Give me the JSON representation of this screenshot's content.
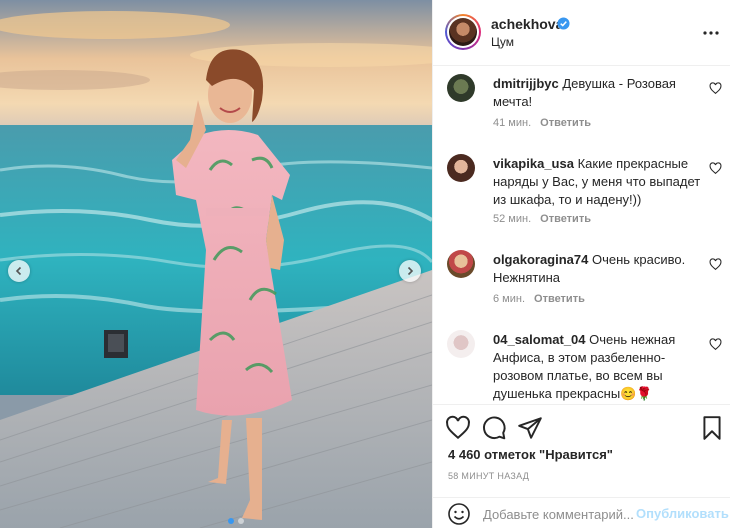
{
  "post": {
    "username": "achekhova",
    "location": "Цум",
    "likes_text": "4 460 отметок \"Нравится\"",
    "time_ago": "58 МИНУТ НАЗАД"
  },
  "comments": [
    {
      "user": "dmitrijjbyc",
      "text": "Девушка - Розовая мечта!",
      "time": "41 мин.",
      "reply": "Ответить"
    },
    {
      "user": "vikapika_usa",
      "text": "Какие прекрасные наряды у Вас, у меня что выпадет из шкафа, то и надену!))",
      "time": "52 мин.",
      "reply": "Ответить"
    },
    {
      "user": "olgakoragina74",
      "text": "Очень красиво. Нежнятина",
      "time": "6 мин.",
      "reply": "Ответить"
    },
    {
      "user": "04_salomat_04",
      "text": "Очень нежная Анфиса, в этом разбеленно-розовом платье, во всем вы душенька прекрасны😊🌹",
      "time": "",
      "reply": ""
    }
  ],
  "add_comment": {
    "placeholder": "Добавьте комментарий...",
    "post_label": "Опубликовать"
  },
  "icons": {
    "verified": "verified-badge-icon",
    "more": "more-options-icon",
    "like": "heart-icon",
    "comment": "comment-icon",
    "share": "paper-plane-icon",
    "save": "bookmark-icon",
    "emoji": "smiley-icon",
    "prev": "chevron-left-icon",
    "next": "chevron-right-icon"
  },
  "colors": {
    "verified_blue": "#3897f0",
    "post_button_disabled": "#b2dffc",
    "muted_text": "#8e8e8e"
  }
}
